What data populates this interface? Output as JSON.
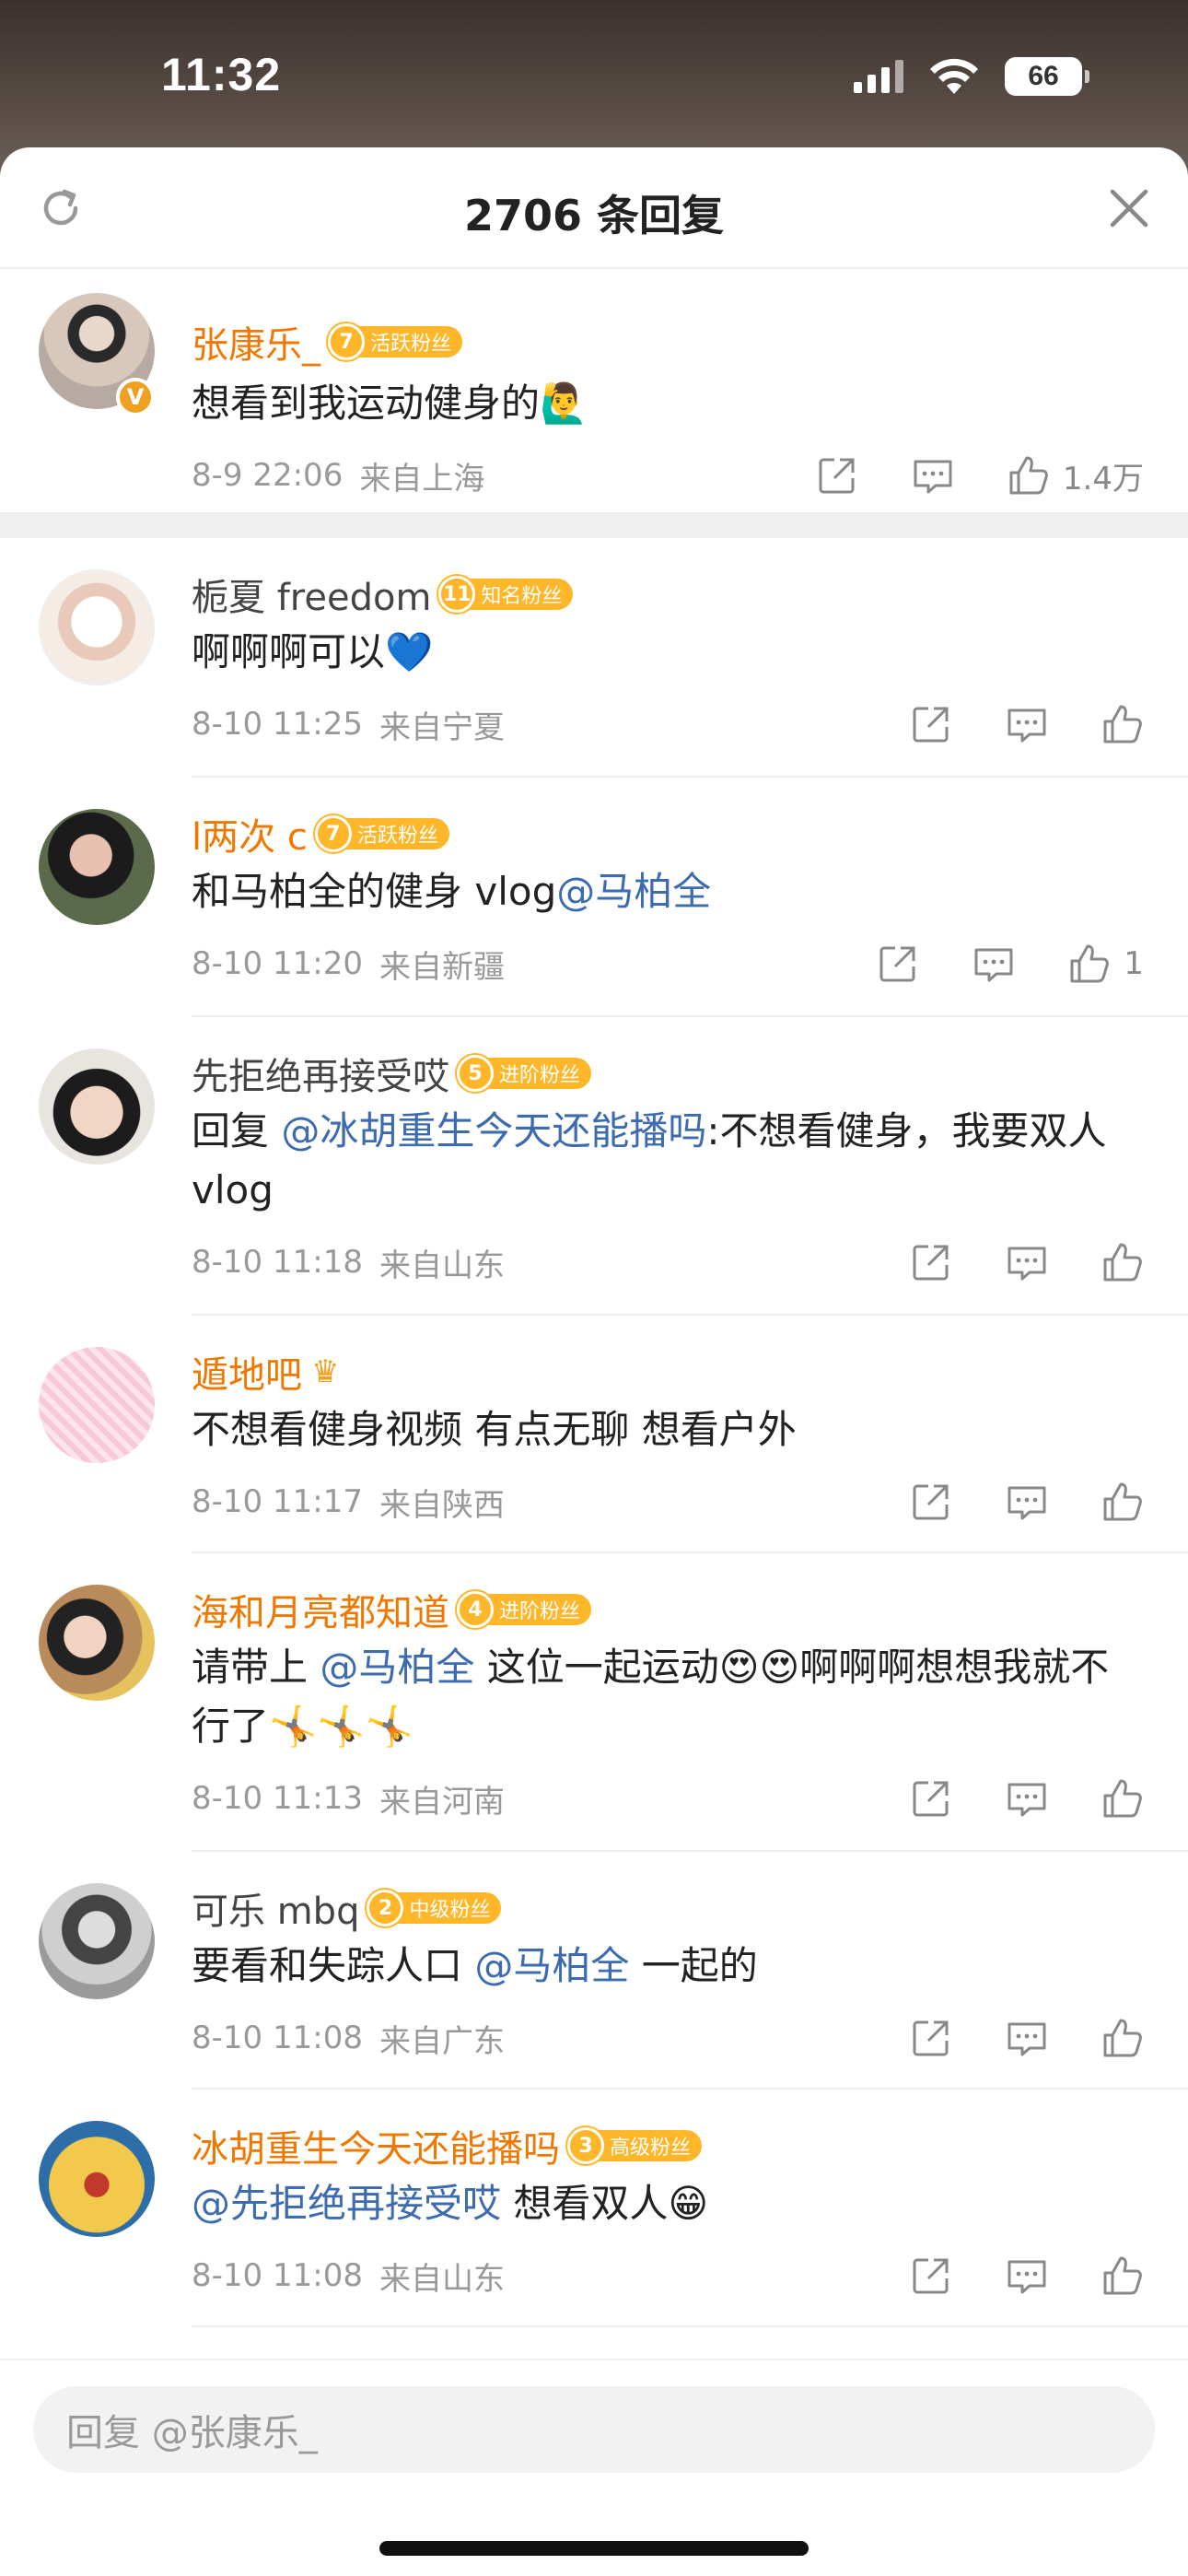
{
  "status_bar": {
    "time": "11:32",
    "battery": "66"
  },
  "header": {
    "title": "2706 条回复"
  },
  "top_comment": {
    "username": "张康乐_",
    "badge_level": "7",
    "badge_text": "活跃粉丝",
    "text": "想看到我运动健身的🙋‍♂️",
    "date": "8-9 22:06",
    "location": "来自上海",
    "likes": "1.4万"
  },
  "replies": [
    {
      "username": "栀夏 freedom",
      "badge_level": "11",
      "badge_text": "知名粉丝",
      "text": "啊啊啊可以💙",
      "date": "8-10 11:25",
      "location": "来自宁夏",
      "likes": ""
    },
    {
      "username": "l两次 c",
      "badge_level": "7",
      "badge_text": "活跃粉丝",
      "text_pre": "和马柏全的健身 vlog",
      "mention": "@马柏全",
      "text_post": "",
      "date": "8-10 11:20",
      "location": "来自新疆",
      "likes": "1"
    },
    {
      "username": "先拒绝再接受哎",
      "badge_level": "5",
      "badge_text": "进阶粉丝",
      "text_pre": "回复 ",
      "mention": "@冰胡重生今天还能播吗",
      "text_post": ":不想看健身，我要双人 vlog",
      "date": "8-10 11:18",
      "location": "来自山东",
      "likes": ""
    },
    {
      "username": "遁地吧",
      "text": "不想看健身视频 有点无聊  想看户外",
      "date": "8-10 11:17",
      "location": "来自陕西",
      "likes": ""
    },
    {
      "username": "海和月亮都知道",
      "badge_level": "4",
      "badge_text": "进阶粉丝",
      "text_pre": "请带上 ",
      "mention": "@马柏全",
      "text_post": " 这位一起运动😍😍啊啊啊想想我就不行了🤸🤸🤸",
      "date": "8-10 11:13",
      "location": "来自河南",
      "likes": ""
    },
    {
      "username": "可乐 mbq",
      "badge_level": "2",
      "badge_text": "中级粉丝",
      "text_pre": "要看和失踪人口 ",
      "mention": "@马柏全",
      "text_post": " 一起的",
      "date": "8-10 11:08",
      "location": "来自广东",
      "likes": ""
    },
    {
      "username": "冰胡重生今天还能播吗",
      "badge_level": "3",
      "badge_text": "高级粉丝",
      "text_pre": "",
      "mention": "@先拒绝再接受哎",
      "text_post": " 想看双人😁",
      "date": "8-10 11:08",
      "location": "来自山东",
      "likes": ""
    }
  ],
  "reply_input": {
    "placeholder": "回复 @张康乐_"
  },
  "colors": {
    "username": "#f07800",
    "mention": "#3d6bb0",
    "badge": "#ffb629"
  }
}
